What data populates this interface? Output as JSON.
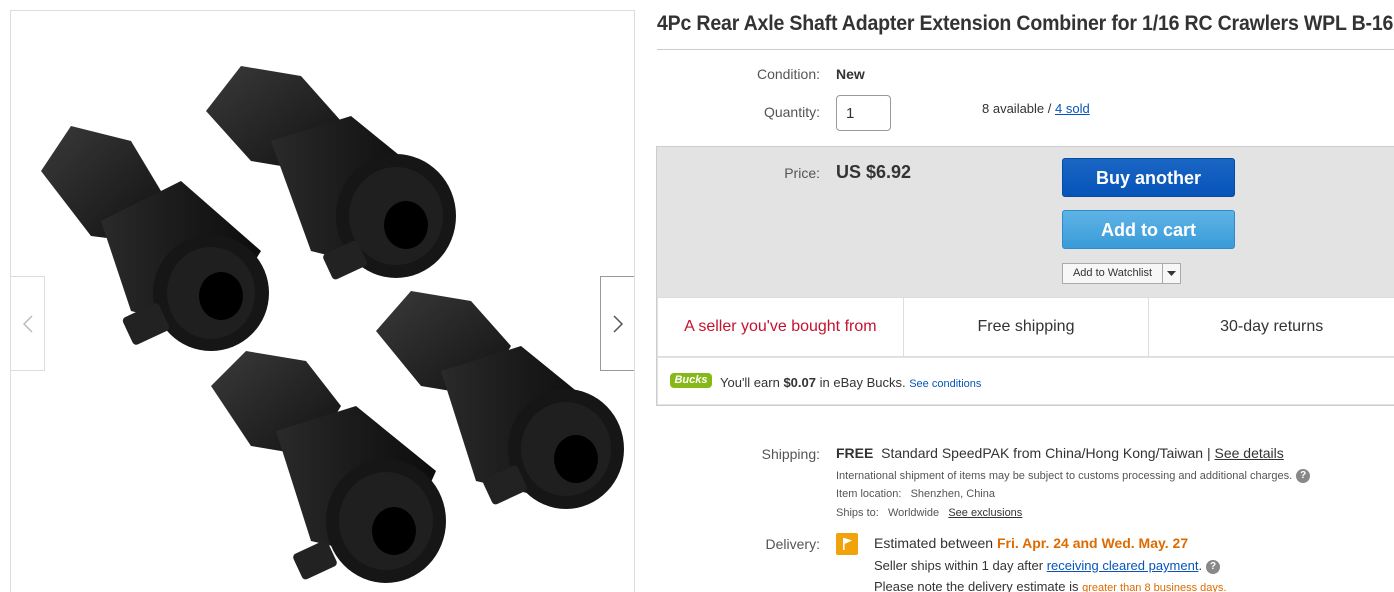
{
  "listing": {
    "title": "4Pc Rear Axle Shaft Adapter Extension Combiner for 1/16 RC Crawlers WPL B-16"
  },
  "gallery": {
    "prev_icon": "chevron-left-icon",
    "next_icon": "chevron-right-icon"
  },
  "condition": {
    "label": "Condition:",
    "value": "New"
  },
  "quantity": {
    "label": "Quantity:",
    "value": "1",
    "available": "8 available",
    "separator": " / ",
    "sold": "4 sold"
  },
  "price": {
    "label": "Price:",
    "value": "US $6.92"
  },
  "actions": {
    "buy_label": "Buy another",
    "cart_label": "Add to cart",
    "watch_label": "Add to Watchlist"
  },
  "features": [
    "A seller you've bought from",
    "Free shipping",
    "30-day returns"
  ],
  "bucks": {
    "logo": "Bucks",
    "earn_prefix": "You'll earn ",
    "amount": "$0.07",
    "earn_suffix": " in eBay Bucks. ",
    "conditions_link": "See conditions"
  },
  "shipping": {
    "label": "Shipping:",
    "free": "FREE",
    "method": "Standard SpeedPAK from China/Hong Kong/Taiwan | ",
    "details_link": "See details",
    "intl_note": "International shipment of items may be subject to customs processing and additional charges.",
    "location_label": "Item location:",
    "location_value": "Shenzhen, China",
    "ships_to_label": "Ships to:",
    "ships_to_value": "Worldwide",
    "exclusions_link": "See exclusions"
  },
  "delivery": {
    "label": "Delivery:",
    "estimated_prefix": "Estimated between ",
    "estimated_dates": "Fri. Apr. 24 and Wed. May. 27",
    "ships_prefix": "Seller ships within 1 day after ",
    "ships_link": "receiving cleared payment",
    "ships_suffix": ".",
    "note_prefix": "Please note the delivery estimate is ",
    "note_highlight": "greater than 8 business days."
  },
  "colors": {
    "buy_button": "#0654ba",
    "cart_button": "#3a9bd8",
    "seller_red": "#c4122f",
    "delivery_orange": "#dd6b00",
    "bucks_green": "#86b817"
  }
}
